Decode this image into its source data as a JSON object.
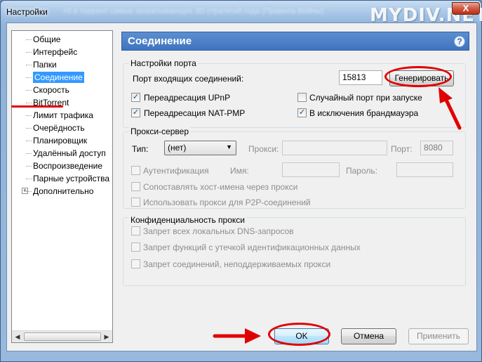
{
  "window": {
    "title": "Настройки",
    "blurred_title": "+0 в торрент самых захватывающих 3D стратегий года (Правила Войны)",
    "watermark": "MYDIV.NET",
    "close_label": "X"
  },
  "tree": {
    "items": [
      {
        "label": "Общие",
        "selected": false
      },
      {
        "label": "Интерфейс",
        "selected": false
      },
      {
        "label": "Папки",
        "selected": false
      },
      {
        "label": "Соединение",
        "selected": true
      },
      {
        "label": "Скорость",
        "selected": false
      },
      {
        "label": "BitTorrent",
        "selected": false
      },
      {
        "label": "Лимит трафика",
        "selected": false
      },
      {
        "label": "Очерёдность",
        "selected": false
      },
      {
        "label": "Планировщик",
        "selected": false
      },
      {
        "label": "Удалённый доступ",
        "selected": false
      },
      {
        "label": "Воспроизведение",
        "selected": false
      },
      {
        "label": "Парные устройства",
        "selected": false
      },
      {
        "label": "Дополнительно",
        "selected": false,
        "expander": "+"
      }
    ]
  },
  "panel": {
    "title": "Соединение",
    "help_icon": "?"
  },
  "port": {
    "legend": "Настройки порта",
    "incoming_label": "Порт входящих соединений:",
    "incoming_value": "15813",
    "generate_label": "Генерировать",
    "upnp_label": "Переадресация UPnP",
    "natpmp_label": "Переадресация NAT-PMP",
    "random_label": "Случайный порт при запуске",
    "firewall_label": "В исключения брандмауэра",
    "upnp_checked": true,
    "natpmp_checked": true,
    "random_checked": false,
    "firewall_checked": true
  },
  "proxy": {
    "legend": "Прокси-сервер",
    "type_label": "Тип:",
    "type_value": "(нет)",
    "proxy_label": "Прокси:",
    "proxy_value": "",
    "port_label": "Порт:",
    "port_value": "8080",
    "auth_label": "Аутентификация",
    "name_label": "Имя:",
    "password_label": "Пароль:",
    "resolve_label": "Сопоставлять хост-имена через прокси",
    "p2p_label": "Использовать прокси для P2P-соединений"
  },
  "privacy": {
    "legend": "Конфиденциальность прокси",
    "dns_label": "Запрет всех локальных DNS-запросов",
    "leak_label": "Запрет функций с утечкой идентификационных данных",
    "unsupported_label": "Запрет соединений, неподдерживаемых прокси"
  },
  "buttons": {
    "ok": "OK",
    "cancel": "Отмена",
    "apply": "Применить"
  },
  "colors": {
    "annotation": "#e00000",
    "header": "#3f74bf",
    "selection": "#3399ff"
  }
}
